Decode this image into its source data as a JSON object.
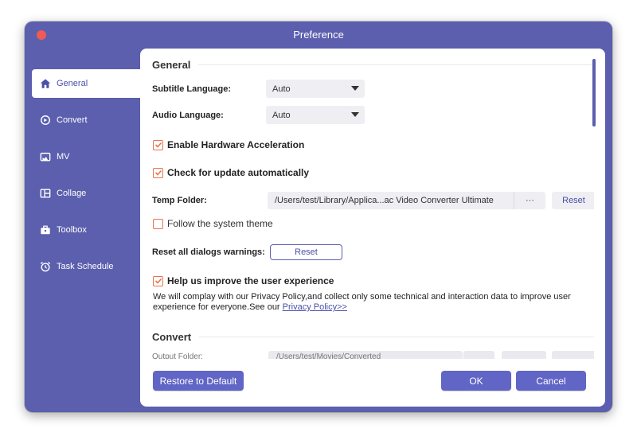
{
  "window": {
    "title": "Preference"
  },
  "sidebar": {
    "items": [
      {
        "label": "General",
        "icon": "home-icon",
        "active": true
      },
      {
        "label": "Convert",
        "icon": "convert-icon",
        "active": false
      },
      {
        "label": "MV",
        "icon": "mv-icon",
        "active": false
      },
      {
        "label": "Collage",
        "icon": "collage-icon",
        "active": false
      },
      {
        "label": "Toolbox",
        "icon": "toolbox-icon",
        "active": false
      },
      {
        "label": "Task Schedule",
        "icon": "alarm-clock-icon",
        "active": false
      }
    ]
  },
  "general": {
    "heading": "General",
    "subtitle_language": {
      "label": "Subtitle Language:",
      "value": "Auto"
    },
    "audio_language": {
      "label": "Audio Language:",
      "value": "Auto"
    },
    "hardware_acceleration": {
      "label": "Enable Hardware Acceleration",
      "checked": true
    },
    "check_update": {
      "label": "Check for update automatically",
      "checked": true
    },
    "temp_folder": {
      "label": "Temp Folder:",
      "path": "/Users/test/Library/Applica...ac Video Converter Ultimate",
      "browse_label": "···",
      "reset_label": "Reset"
    },
    "follow_theme": {
      "label": "Follow the system theme",
      "checked": false
    },
    "reset_dialogs": {
      "label": "Reset all dialogs warnings:",
      "button_label": "Reset"
    },
    "improve_experience": {
      "label": "Help us improve the user experience",
      "checked": true,
      "description": "We will complay with our Privacy Policy,and collect only some technical and interaction data to improve user experience for everyone.See our ",
      "link_label": "Privacy Policy>>"
    }
  },
  "convert": {
    "heading": "Convert",
    "output_folder_label": "Output Folder:",
    "output_folder_path": "/Users/test/Movies/Converted"
  },
  "footer": {
    "restore_label": "Restore to Default",
    "ok_label": "OK",
    "cancel_label": "Cancel"
  },
  "colors": {
    "window_bg": "#5b5fae",
    "accent": "#6065c6",
    "checkbox": "#e8734a",
    "close_dot": "#ee5b52"
  }
}
